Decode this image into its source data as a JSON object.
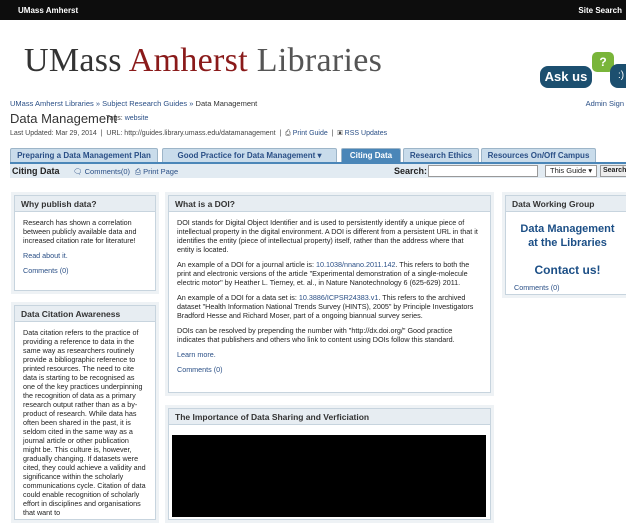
{
  "topbar": {
    "org": "UMass Amherst",
    "site_search": "Site Search"
  },
  "logo": {
    "part1": "UMass ",
    "part2": "Amherst",
    "part3": " Libraries"
  },
  "askus": {
    "label": "Ask us",
    "q": "?",
    "smile": ":)"
  },
  "breadcrumb": {
    "item1": "UMass Amherst Libraries",
    "sep": "»",
    "item2": "Subject Research Guides",
    "current": "Data Management"
  },
  "admin": "Admin Sign",
  "page": {
    "title": "Data Management",
    "tags_label": "Tags:",
    "tags_value": "website"
  },
  "meta": {
    "updated": "Last Updated: Mar 29, 2014",
    "url_label": "URL: http://guides.library.umass.edu/datamanagement",
    "print_guide": "Print Guide",
    "rss": "RSS Updates"
  },
  "tabs": [
    {
      "label": "Preparing a Data Management Plan"
    },
    {
      "label": "Good Practice for Data Management ▾"
    },
    {
      "label": "Citing Data"
    },
    {
      "label": "Research Ethics"
    },
    {
      "label": "Resources On/Off Campus"
    }
  ],
  "toolbar": {
    "title": "Citing Data",
    "comments": "Comments(0)",
    "print": "Print Page",
    "search_label": "Search:",
    "scope": "This Guide",
    "button": "Search"
  },
  "left": {
    "why": {
      "title": "Why publish data?",
      "body": "Research has shown a correlation between publicly available data and increased citation rate for literature!",
      "read": "Read about it.",
      "comments": "Comments (0)"
    },
    "awareness": {
      "title": "Data Citation Awareness",
      "body": "Data citation refers to the practice of providing a reference to data in the same way as researchers routinely provide a bibliographic reference to printed resources. The need to cite data is starting to be recognised as one of the key practices underpinning the recognition of data as a primary research output rather than as a by-product of research. While data has often been shared in the past, it is seldom cited in the same way as a journal article or other publication might be. This culture is, however, gradually changing. If datasets were cited, they could achieve a validity and significance within the scholarly communications cycle. Citation of data could enable recognition of scholarly effort in disciplines and organisations that want to"
    }
  },
  "center": {
    "doi": {
      "title": "What is a DOI?",
      "p1": "DOI stands for Digital Object Identifier and is used to persistently identify a unique piece of intellectual property in the digital environment. A DOI is different from a persistent URL in that it identifies the entity (piece of intellectual property) itself, rather than the address where that entity is located.",
      "p2a": "An example of a DOI for a journal article is: ",
      "p2link": "10.1038/nnano.2011.142",
      "p2b": ". This refers to both the print and electronic versions of the article \"Experimental demonstration of a single-molecule electric motor\" by Heather L. Tierney, et. al., in Nature Nanotechnology 6 (625-629) 2011.",
      "p3a": "An example of a DOI for a data set is: ",
      "p3link": "10.3886/ICPSR24383.v1",
      "p3b": ". This refers to the archived dataset \"Health Information National Trends Survey (HINTS), 2005\" by Principle Investigators Bradford Hesse and Richard Moser, part of a ongoing biannual survey series.",
      "p4": "DOIs can be resolved by prepending the number with \"http://dx.doi.org/\" Good practice indicates that publishers and others who link to content using DOIs follow this standard.",
      "learn": "Learn more.",
      "comments": "Comments (0)"
    },
    "sharing": {
      "title": "The Importance of Data Sharing and Verficiation"
    }
  },
  "right": {
    "dwg": {
      "title": "Data Working Group",
      "line1": "Data Management",
      "line2": "at the Libraries",
      "contact": "Contact us!",
      "comments": "Comments (0)"
    }
  }
}
